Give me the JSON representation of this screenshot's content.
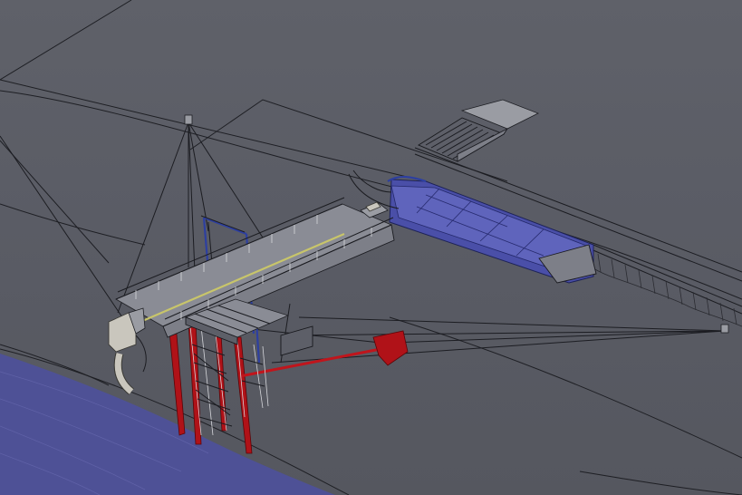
{
  "scene": {
    "colors": {
      "background": "#5a5c66",
      "water": "#4e5196",
      "barge": "#4a4fa8",
      "red_structure": "#b01218",
      "steel": "#7d7f88",
      "outline": "#1c1d22"
    },
    "icons": {
      "loader_tower": "ship-loader-icon",
      "barge": "barge-icon",
      "hopper": "hopper-icon"
    }
  }
}
